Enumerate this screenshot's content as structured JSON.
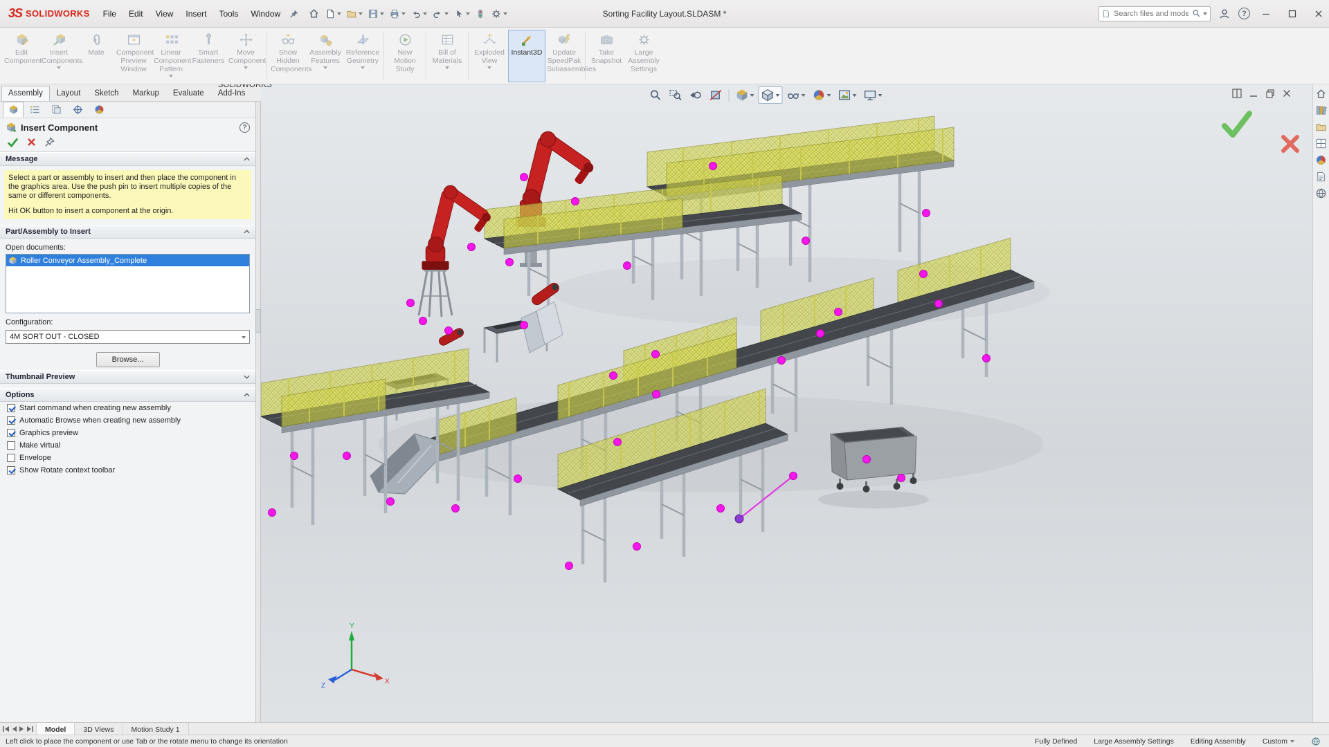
{
  "titlebar": {
    "brand": "SOLIDWORKS",
    "brand_mark": "3S",
    "menus": [
      "File",
      "Edit",
      "View",
      "Insert",
      "Tools",
      "Window"
    ],
    "title": "Sorting Facility Layout.SLDASM *",
    "search_placeholder": "Search files and models"
  },
  "icons": {
    "help_glyph": "?"
  },
  "ribbon": {
    "buttons": [
      {
        "label": "Edit Component"
      },
      {
        "label": "Insert Components"
      },
      {
        "label": "Mate"
      },
      {
        "label": "Component Preview Window"
      },
      {
        "label": "Linear Component Pattern"
      },
      {
        "label": "Smart Fasteners"
      },
      {
        "label": "Move Component"
      },
      {
        "label": "Show Hidden Components"
      },
      {
        "label": "Assembly Features"
      },
      {
        "label": "Reference Geometry"
      },
      {
        "label": "New Motion Study"
      },
      {
        "label": "Bill of Materials"
      },
      {
        "label": "Exploded View"
      },
      {
        "label": "Instant3D"
      },
      {
        "label": "Update SpeedPak Subassemblies"
      },
      {
        "label": "Take Snapshot"
      },
      {
        "label": "Large Assembly Settings"
      }
    ]
  },
  "command_tabs": {
    "items": [
      "Assembly",
      "Layout",
      "Sketch",
      "Markup",
      "Evaluate",
      "SOLIDWORKS Add-Ins"
    ]
  },
  "property_panel": {
    "title": "Insert Component",
    "sections": {
      "message": "Message",
      "part": "Part/Assembly to Insert",
      "thumbnail": "Thumbnail Preview",
      "options": "Options"
    },
    "message": {
      "p1": "Select a part or assembly to insert and then place the component in the graphics area. Use the push pin to insert multiple copies of the same or different components.",
      "p2": "Hit OK button to insert a component at the origin."
    },
    "open_documents_label": "Open documents:",
    "documents": [
      {
        "name": "Roller Conveyor Assembly_Complete"
      }
    ],
    "configuration_label": "Configuration:",
    "configuration_value": "4M SORT OUT - CLOSED",
    "browse_label": "Browse...",
    "options": [
      {
        "label": "Start command when creating new assembly",
        "checked": true
      },
      {
        "label": "Automatic Browse when creating new assembly",
        "checked": true
      },
      {
        "label": "Graphics preview",
        "checked": true
      },
      {
        "label": "Make virtual",
        "checked": false
      },
      {
        "label": "Envelope",
        "checked": false
      },
      {
        "label": "Show Rotate context toolbar",
        "checked": true
      }
    ]
  },
  "viewport": {
    "triad": {
      "x": "X",
      "y": "Y",
      "z": "Z"
    }
  },
  "doc_tabs": {
    "items": [
      "Model",
      "3D Views",
      "Motion Study 1"
    ]
  },
  "statusbar": {
    "hint": "Left click to place the component or use Tab or the rotate menu to change its orientation",
    "state": "Fully Defined",
    "assembly_mode": "Large Assembly Settings",
    "editing": "Editing Assembly",
    "display_state": "Custom"
  }
}
